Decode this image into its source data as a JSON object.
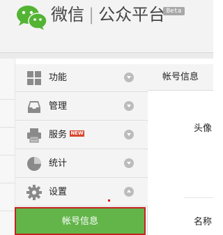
{
  "header": {
    "brand_name": "微信",
    "separator": "|",
    "platform_name": "公众平台",
    "badge": "Beta",
    "logo_icon": "wechat-logo-icon"
  },
  "sidebar": {
    "items": [
      {
        "label": "功能",
        "icon": "grid-icon",
        "toggle": "expand"
      },
      {
        "label": "管理",
        "icon": "inbox-tray-icon",
        "toggle": "expand"
      },
      {
        "label": "服务",
        "icon": "printer-icon",
        "toggle": "expand",
        "badge": "NEW"
      },
      {
        "label": "统计",
        "icon": "pie-chart-icon",
        "toggle": "expand"
      },
      {
        "label": "设置",
        "icon": "gear-icon",
        "toggle": "collapse"
      }
    ],
    "active_subitem": {
      "label": "帐号信息"
    }
  },
  "content": {
    "tab_label": "帐号信息",
    "avatar_label": "头像",
    "name_label": "名称"
  },
  "colors": {
    "accent_green": "#63b54a",
    "highlight_border": "#c42222",
    "new_badge": "#d8452c"
  }
}
